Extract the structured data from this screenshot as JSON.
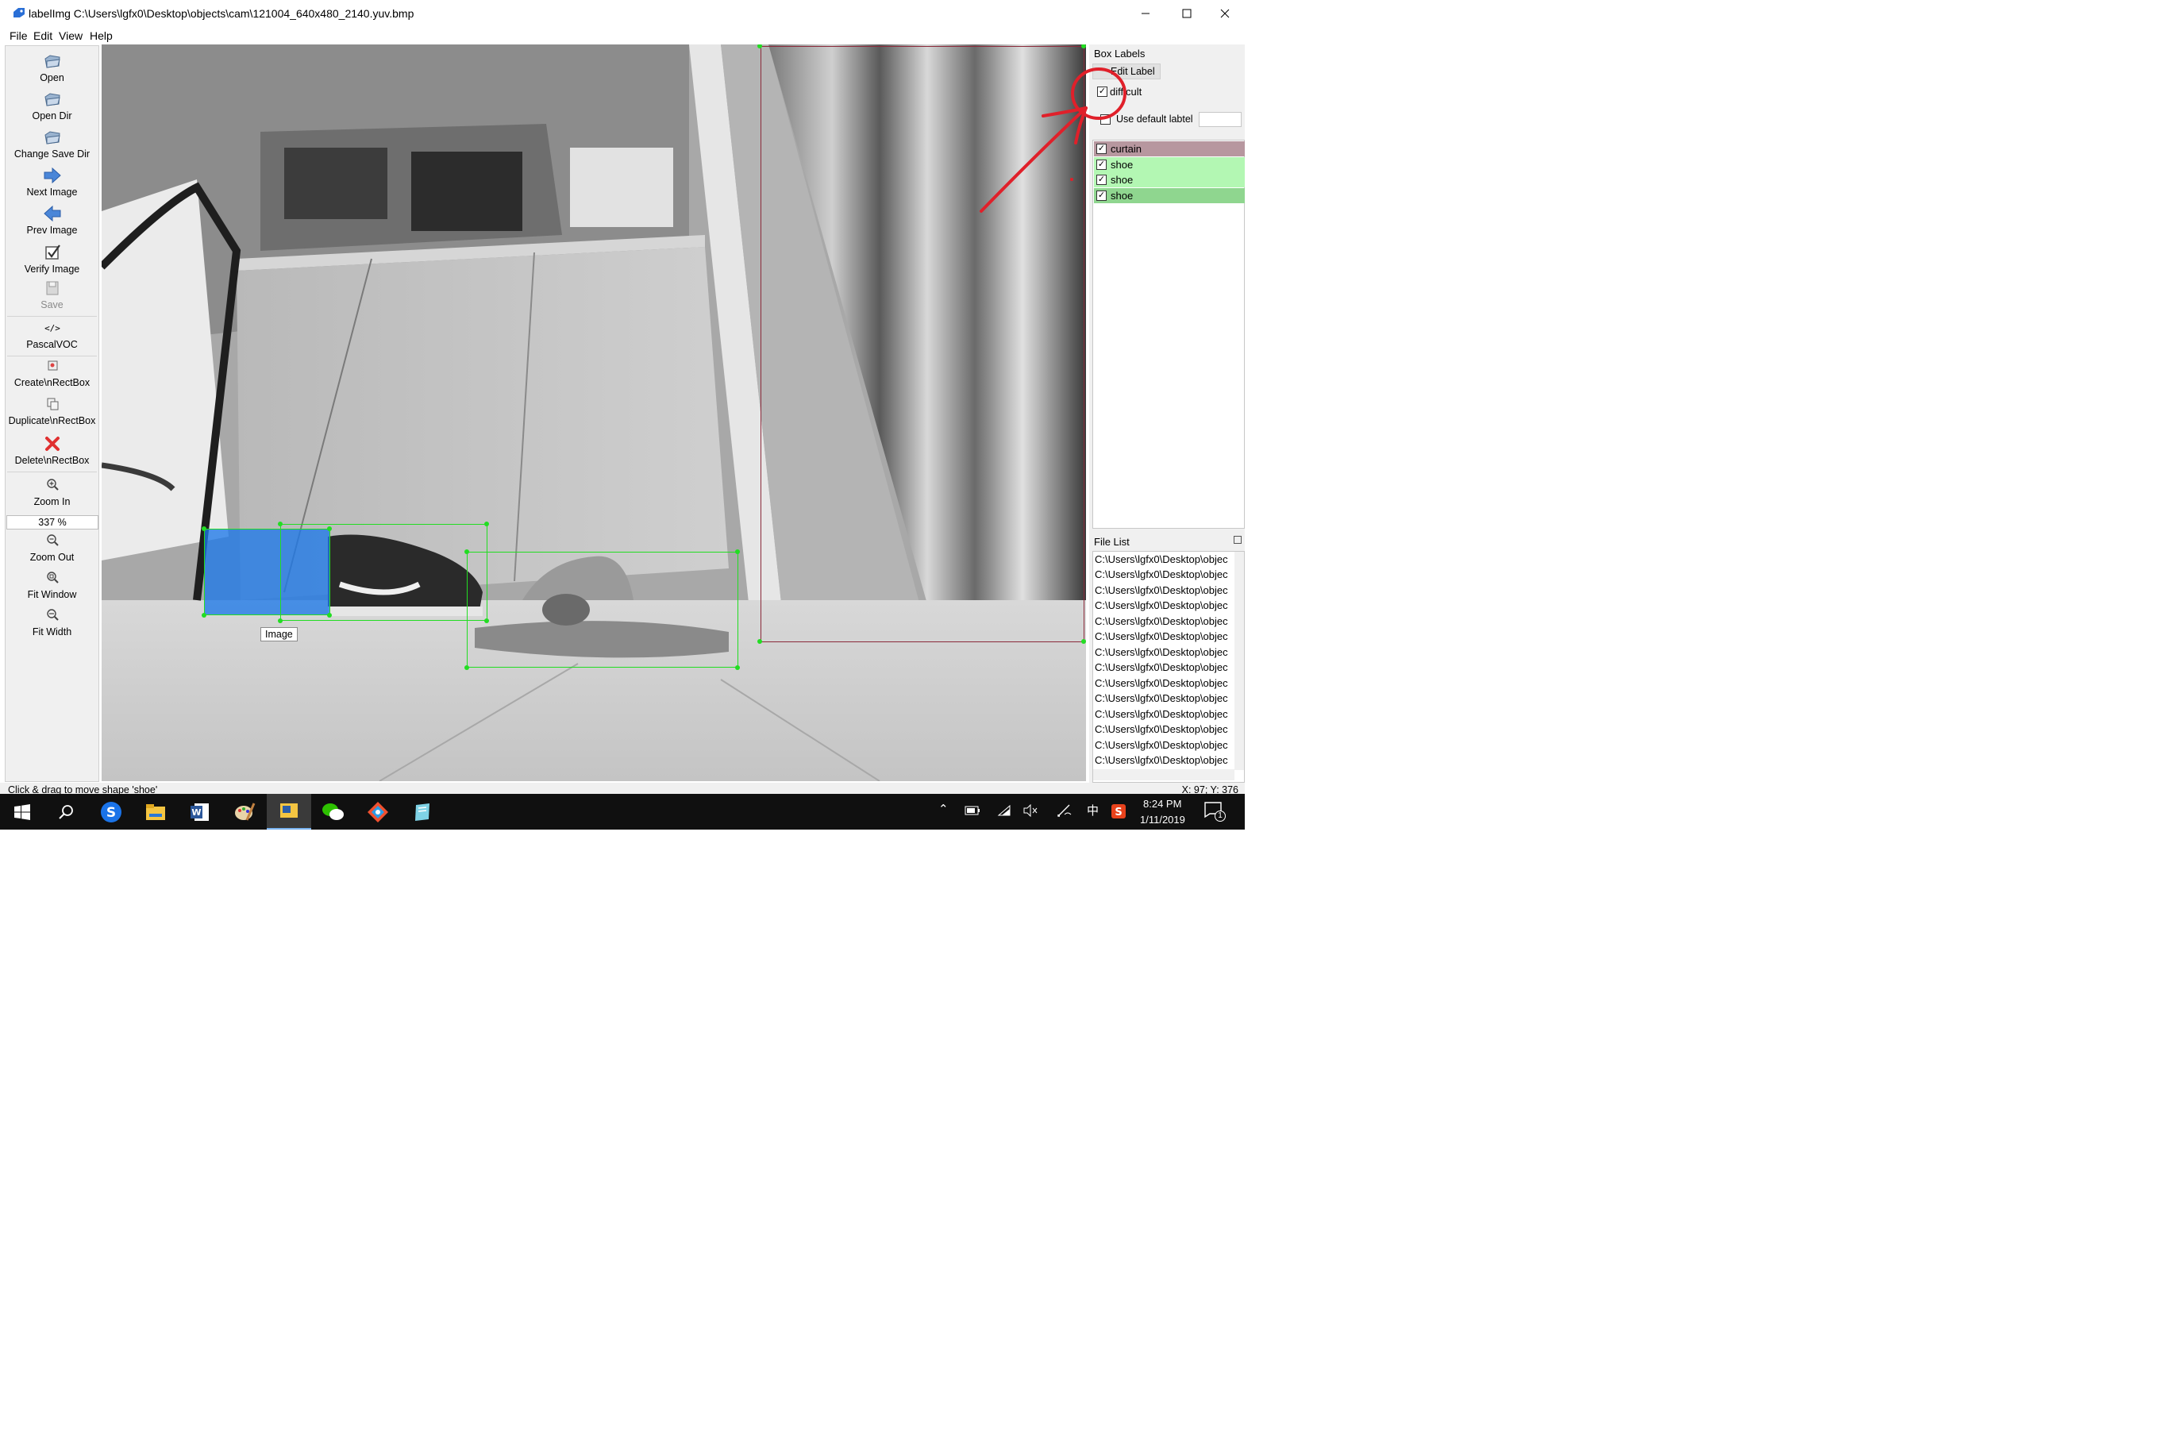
{
  "window": {
    "title": "labelImg C:\\Users\\lgfx0\\Desktop\\objects\\cam\\121004_640x480_2140.yuv.bmp"
  },
  "menu": [
    "File",
    "Edit",
    "View",
    "Help"
  ],
  "toolbar": {
    "open": "Open",
    "open_dir": "Open Dir",
    "change_save_dir": "Change Save Dir",
    "next_image": "Next Image",
    "prev_image": "Prev Image",
    "verify_image": "Verify Image",
    "save": "Save",
    "format": "PascalVOC",
    "create_rectbox": "Create\\nRectBox",
    "duplicate_rectbox": "Duplicate\\nRectBox",
    "delete_rectbox": "Delete\\nRectBox",
    "zoom_in": "Zoom In",
    "zoom_value": "337 %",
    "zoom_out": "Zoom Out",
    "fit_window": "Fit Window",
    "fit_width": "Fit Width"
  },
  "canvas": {
    "tooltip": "Image"
  },
  "box_labels": {
    "title": "Box Labels",
    "edit_label": "Edit Label",
    "difficult": "difficult",
    "difficult_checked": true,
    "use_default_label": "Use default labtel",
    "use_default_checked": false,
    "default_label_value": "",
    "labels": [
      {
        "name": "curtain",
        "checked": true,
        "color": "#b7979f"
      },
      {
        "name": "shoe",
        "checked": true,
        "color": "#b3f7b3"
      },
      {
        "name": "shoe",
        "checked": true,
        "color": "#b3f7b3"
      },
      {
        "name": "shoe",
        "checked": true,
        "color": "#8fd68f"
      }
    ]
  },
  "file_list": {
    "title": "File List",
    "items": [
      "C:\\Users\\lgfx0\\Desktop\\objec",
      "C:\\Users\\lgfx0\\Desktop\\objec",
      "C:\\Users\\lgfx0\\Desktop\\objec",
      "C:\\Users\\lgfx0\\Desktop\\objec",
      "C:\\Users\\lgfx0\\Desktop\\objec",
      "C:\\Users\\lgfx0\\Desktop\\objec",
      "C:\\Users\\lgfx0\\Desktop\\objec",
      "C:\\Users\\lgfx0\\Desktop\\objec",
      "C:\\Users\\lgfx0\\Desktop\\objec",
      "C:\\Users\\lgfx0\\Desktop\\objec",
      "C:\\Users\\lgfx0\\Desktop\\objec",
      "C:\\Users\\lgfx0\\Desktop\\objec",
      "C:\\Users\\lgfx0\\Desktop\\objec",
      "C:\\Users\\lgfx0\\Desktop\\objec"
    ]
  },
  "status": {
    "message": "Click & drag to move shape 'shoe'",
    "coords": "X: 97; Y: 376"
  },
  "taskbar": {
    "time": "8:24 PM",
    "date": "1/11/2019",
    "ime": "中",
    "notification_count": "1"
  },
  "colors": {
    "annotation_red": "#e0202a",
    "box_green": "#22dd22",
    "selected_fill": "#1e78e8"
  }
}
